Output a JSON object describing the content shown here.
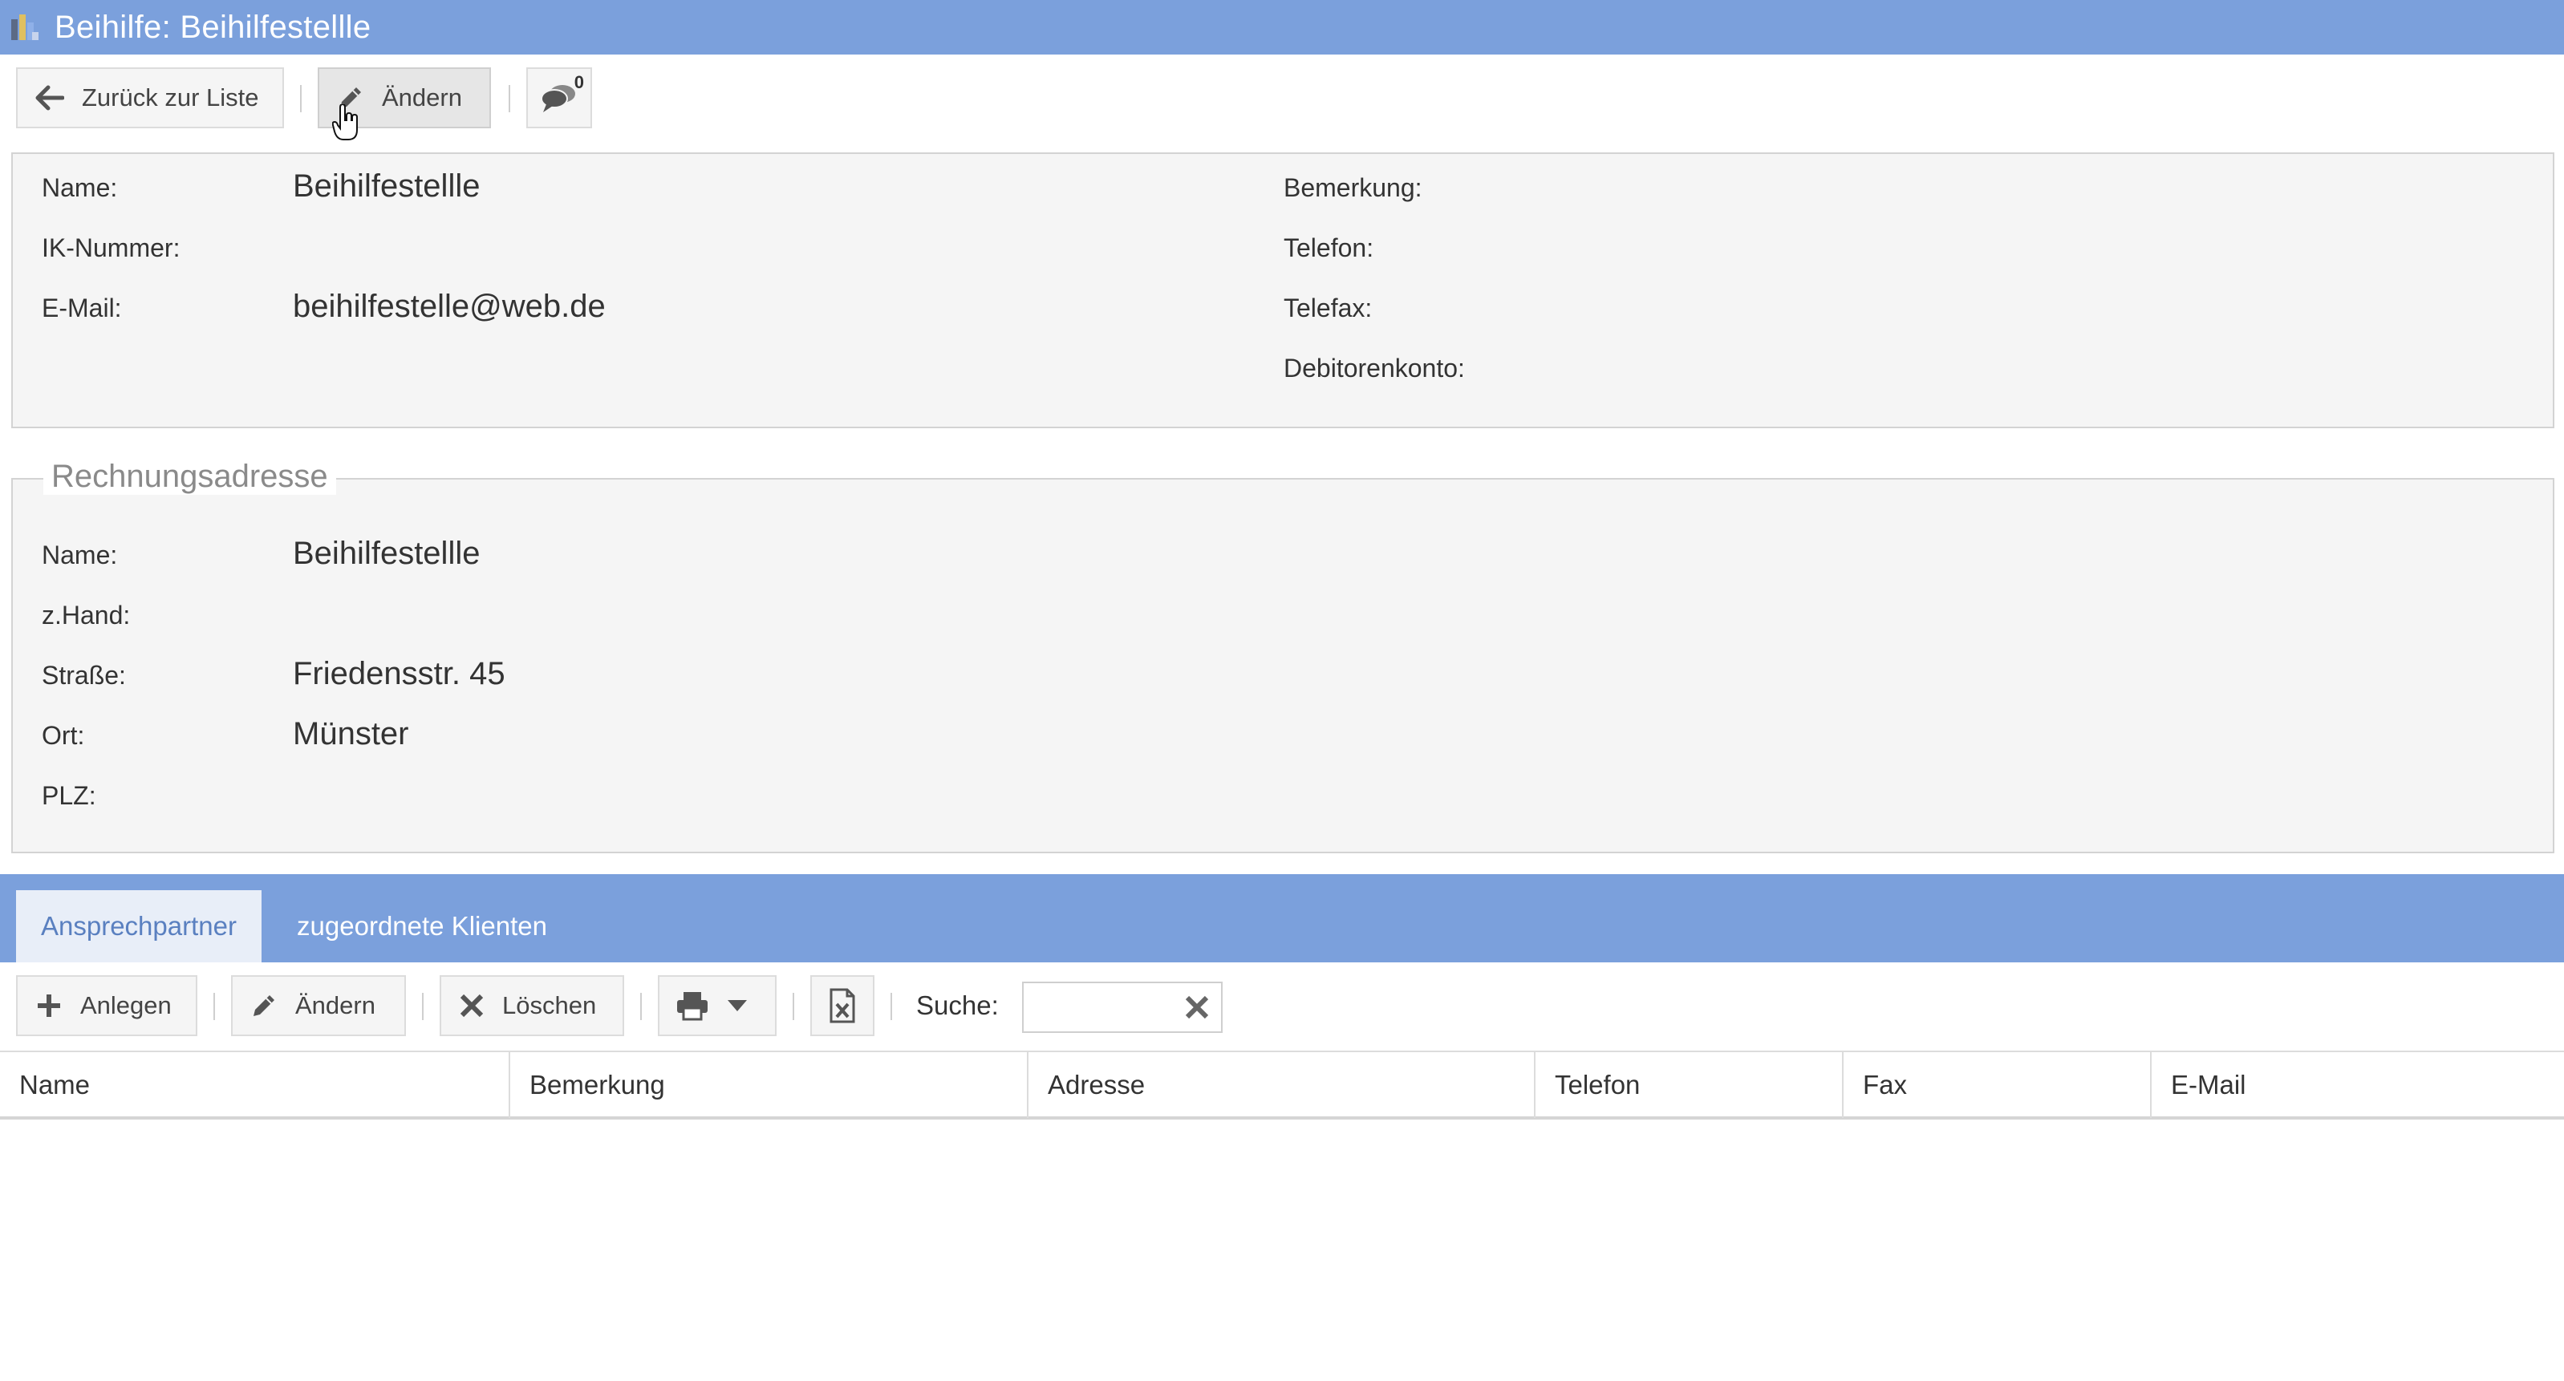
{
  "window": {
    "title": "Beihilfe: Beihilfestellle"
  },
  "toolbar": {
    "back_label": "Zurück zur Liste",
    "edit_label": "Ändern",
    "comments_count": "0"
  },
  "details": {
    "name_label": "Name:",
    "name_value": "Beihilfestellle",
    "ik_label": "IK-Nummer:",
    "ik_value": "",
    "email_label": "E-Mail:",
    "email_value": "beihilfestelle@web.de",
    "bemerkung_label": "Bemerkung:",
    "bemerkung_value": "",
    "telefon_label": "Telefon:",
    "telefon_value": "",
    "telefax_label": "Telefax:",
    "telefax_value": "",
    "debitor_label": "Debitorenkonto:",
    "debitor_value": ""
  },
  "billing": {
    "legend": "Rechnungsadresse",
    "name_label": "Name:",
    "name_value": "Beihilfestellle",
    "zhand_label": "z.Hand:",
    "zhand_value": "",
    "strasse_label": "Straße:",
    "strasse_value": "Friedensstr. 45",
    "ort_label": "Ort:",
    "ort_value": "Münster",
    "plz_label": "PLZ:",
    "plz_value": ""
  },
  "tabs": [
    {
      "label": "Ansprechpartner",
      "active": true
    },
    {
      "label": "zugeordnete Klienten",
      "active": false
    }
  ],
  "grid_toolbar": {
    "add_label": "Anlegen",
    "edit_label": "Ändern",
    "delete_label": "Löschen",
    "search_label": "Suche:",
    "search_value": ""
  },
  "table": {
    "columns": [
      "Name",
      "Bemerkung",
      "Adresse",
      "Telefon",
      "Fax",
      "E-Mail"
    ],
    "rows": []
  },
  "colors": {
    "accent": "#7ba0dc",
    "panel_bg": "#f5f5f5"
  }
}
